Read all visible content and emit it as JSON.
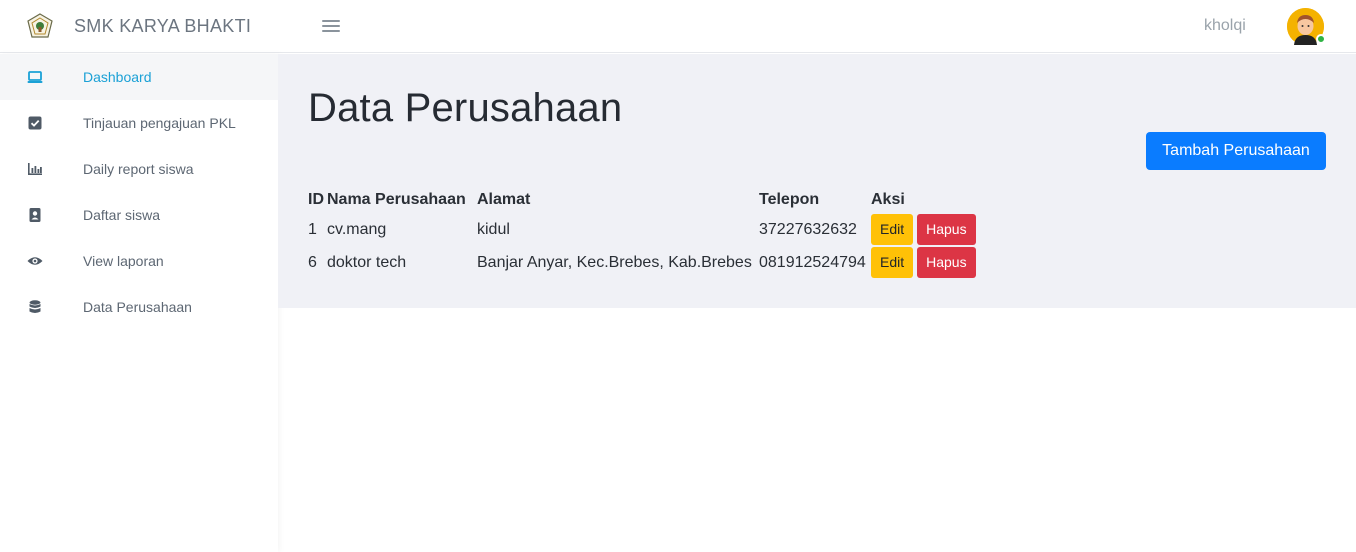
{
  "header": {
    "brand_name": "SMK KARYA BHAKTI",
    "username": "kholqi",
    "logo_icon": "school-logo-icon",
    "menu_icon": "hamburger-icon"
  },
  "sidebar": {
    "items": [
      {
        "label": "Dashboard",
        "icon": "laptop-icon",
        "active": true
      },
      {
        "label": "Tinjauan pengajuan PKL",
        "icon": "checkbox-icon",
        "active": false
      },
      {
        "label": "Daily report siswa",
        "icon": "bar-chart-icon",
        "active": false
      },
      {
        "label": "Daftar siswa",
        "icon": "contact-card-icon",
        "active": false
      },
      {
        "label": "View laporan",
        "icon": "eye-icon",
        "active": false
      },
      {
        "label": "Data Perusahaan",
        "icon": "database-icon",
        "active": false
      }
    ]
  },
  "main": {
    "title": "Data Perusahaan",
    "add_button": "Tambah Perusahaan",
    "table": {
      "headers": [
        "ID",
        "Nama Perusahaan",
        "Alamat",
        "Telepon",
        "Aksi"
      ],
      "rows": [
        {
          "id": "1",
          "nama": "cv.mang",
          "alamat": "kidul",
          "telepon": "37227632632",
          "edit": "Edit",
          "hapus": "Hapus"
        },
        {
          "id": "6",
          "nama": "doktor tech",
          "alamat": "Banjar Anyar, Kec.Brebes, Kab.Brebes",
          "telepon": "081912524794",
          "edit": "Edit",
          "hapus": "Hapus"
        }
      ]
    }
  },
  "colors": {
    "accent": "#1ba1d6",
    "primary_button": "#0a7cff",
    "edit_button": "#ffc107",
    "delete_button": "#dc3545",
    "content_bg": "#f0f1f6",
    "status_online": "#2fb344"
  }
}
